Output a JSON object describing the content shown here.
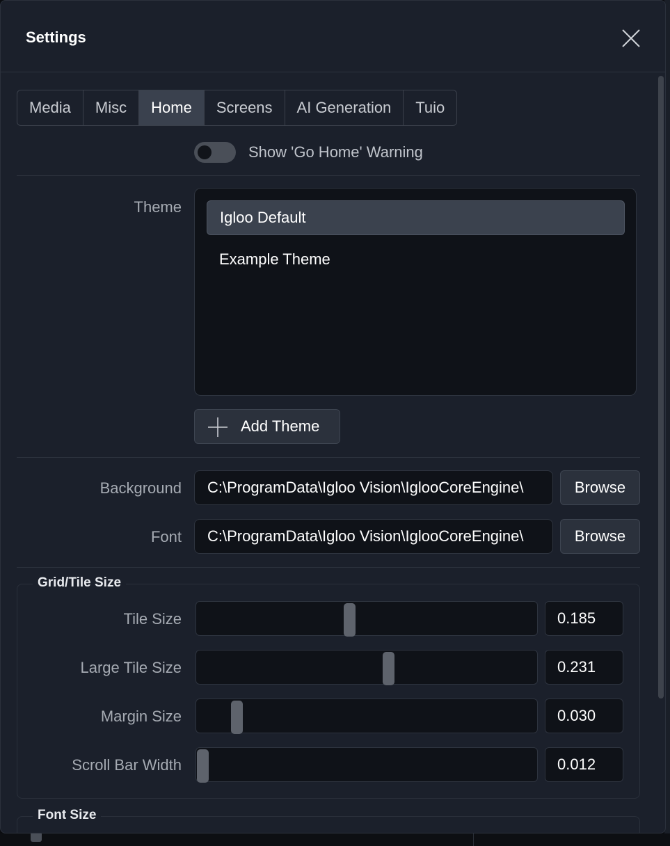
{
  "dialog": {
    "title": "Settings"
  },
  "tabs": [
    {
      "label": "Media",
      "active": false
    },
    {
      "label": "Misc",
      "active": false
    },
    {
      "label": "Home",
      "active": true
    },
    {
      "label": "Screens",
      "active": false
    },
    {
      "label": "AI Generation",
      "active": false
    },
    {
      "label": "Tuio",
      "active": false
    }
  ],
  "warning_toggle": {
    "label": "Show 'Go Home' Warning",
    "checked": false
  },
  "theme": {
    "label": "Theme",
    "items": [
      "Igloo Default",
      "Example Theme"
    ],
    "selected": "Igloo Default",
    "add_label": "Add Theme"
  },
  "background": {
    "label": "Background",
    "value": "C:\\ProgramData\\Igloo Vision\\IglooCoreEngine\\",
    "browse_label": "Browse"
  },
  "font": {
    "label": "Font",
    "value": "C:\\ProgramData\\Igloo Vision\\IglooCoreEngine\\",
    "browse_label": "Browse"
  },
  "grid_tile": {
    "title": "Grid/Tile Size",
    "rows": [
      {
        "label": "Tile Size",
        "value": "0.185"
      },
      {
        "label": "Large Tile Size",
        "value": "0.231"
      },
      {
        "label": "Margin Size",
        "value": "0.030"
      },
      {
        "label": "Scroll Bar Width",
        "value": "0.012"
      }
    ]
  },
  "font_size": {
    "title": "Font Size"
  },
  "colors": {
    "panel": "#1b202b",
    "field": "#0f1218",
    "active_tab": "#3a414e",
    "button": "#2b313c",
    "slider_handle": "#5e636c"
  }
}
